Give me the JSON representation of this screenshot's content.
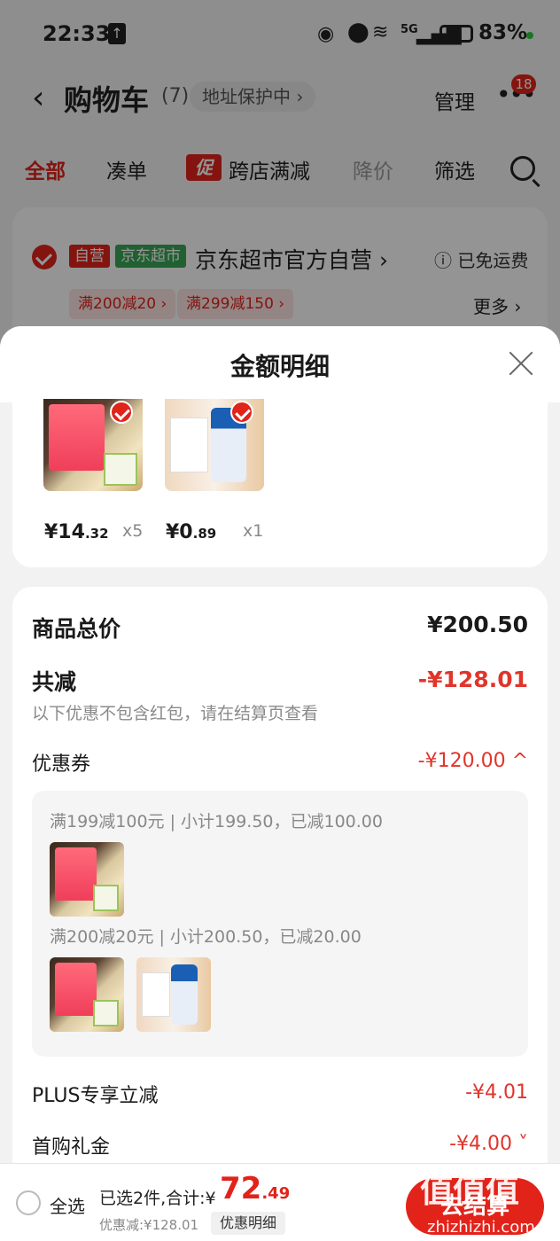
{
  "status_bar": {
    "time": "22:33",
    "network": "5G",
    "battery": "83%"
  },
  "header": {
    "title": "购物车",
    "count": "(7)",
    "address_label": "地址保护中 ›",
    "manage_label": "管理",
    "more_badge": "18"
  },
  "tabs": [
    {
      "label": "全部",
      "state": "active"
    },
    {
      "label": "凑单",
      "state": "normal"
    },
    {
      "label": "跨店满减",
      "state": "normal",
      "icon_text": "促"
    },
    {
      "label": "降价",
      "state": "disabled"
    },
    {
      "label": "筛选",
      "state": "normal"
    }
  ],
  "store": {
    "tag_self": "自营",
    "tag_market": "京东超市",
    "name": "京东超市官方自营 ›",
    "shipping": "ⓘ 已免运费",
    "coupons": [
      "满200减20 ›",
      "满299减150 ›"
    ],
    "more": "更多 ›"
  },
  "sheet": {
    "title": "金额明细",
    "products": [
      {
        "price_int": "¥14",
        "price_dec": ".32",
        "qty": "x5",
        "image": "jd-fresh-pancake-pack"
      },
      {
        "price_int": "¥0",
        "price_dec": ".89",
        "qty": "x1",
        "image": "liquid-glue-bottle"
      }
    ],
    "total_label": "商品总价",
    "total_value": "¥200.50",
    "discount_label": "共减",
    "discount_value": "-¥128.01",
    "discount_note": "以下优惠不包含红包，请在结算页查看",
    "coupon_label": "优惠券",
    "coupon_value": "-¥120.00 ^",
    "coupon_rules": [
      {
        "text": "满199减100元 | 小计199.50，已减100.00"
      },
      {
        "text": "满200减20元 | 小计200.50，已减20.00"
      }
    ],
    "plus_label": "PLUS专享立减",
    "plus_value": "-¥4.01",
    "first_label": "首购礼金",
    "first_value": "-¥4.00 ˅"
  },
  "bottom_bar": {
    "select_all": "全选",
    "summary": "已选2件,合计:¥",
    "total_int": "72",
    "total_dec": ".49",
    "discount_text": "优惠减:¥128.01",
    "detail_button": "优惠明细",
    "checkout_label": "去结算"
  },
  "watermark": {
    "text": "值值值",
    "site": "zhizhizhi.com"
  },
  "colors": {
    "brand_red": "#e2231a",
    "discount_red": "#e0352b",
    "market_green": "#3aa655"
  }
}
